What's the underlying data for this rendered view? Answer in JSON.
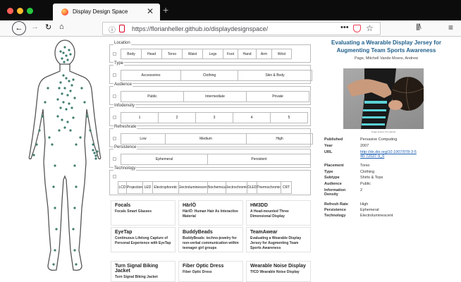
{
  "browser": {
    "tab_title": "Display Design Space",
    "tab_close": "✕",
    "new_tab": "+",
    "back": "←",
    "forward": "→",
    "reload": "↻",
    "home": "⌂",
    "info_icon": "ⓘ",
    "url": "https://florianheller.github.io/displaydesignspace/",
    "page_actions": "•••",
    "bookmark": "☆",
    "library": "|||\\",
    "menu": "≡",
    "colors": {
      "close": "#ff5f57",
      "minimize": "#febc2e",
      "maximize": "#28c840"
    }
  },
  "filters": [
    {
      "legend": "Location",
      "options": [
        "Body",
        "Head",
        "Torso",
        "Waist",
        "Legs",
        "Foot",
        "Hand",
        "Arm",
        "Wrist"
      ]
    },
    {
      "legend": "Type",
      "options": [
        "Accessories",
        "Clothing",
        "Skin & Body"
      ]
    },
    {
      "legend": "Audience",
      "options": [
        "Public",
        "Intermediate",
        "Private"
      ]
    },
    {
      "legend": "Infodensity",
      "options": [
        "1",
        "2",
        "3",
        "4",
        "5"
      ]
    },
    {
      "legend": "Refreshrate",
      "options": [
        "Low",
        "Medium",
        "High"
      ]
    },
    {
      "legend": "Persistence",
      "options": [
        "Ephemeral",
        "Persistent"
      ]
    },
    {
      "legend": "Technology",
      "options": [
        "LCD",
        "Projection",
        "LED",
        "Electrophoretic",
        "Electroluminescent",
        "Biochemical",
        "Electrochromic",
        "OLED",
        "Thermochromic",
        "CRT"
      ]
    }
  ],
  "cards": [
    {
      "title": "Focals",
      "subtitle": "Focals Smart Glasses"
    },
    {
      "title": "HärlÖ",
      "subtitle": "HärlÖ: Human Hair As Interactive Material"
    },
    {
      "title": "HM3DD",
      "subtitle": "A Head-mounted Three Dimensional Display"
    },
    {
      "title": "EyeTap",
      "subtitle": "Continuous Lifelong Capture of Personal Experience with EyeTap"
    },
    {
      "title": "BuddyBeads",
      "subtitle": "BuddyBeads: techno-jewelry for non-verbal communication within teenager girl groups"
    },
    {
      "title": "TeamAwear",
      "subtitle": "Evaluating a Wearable Display Jersey for Augmenting Team Sports Awareness"
    },
    {
      "title": "Turn Signal Biking Jacket",
      "subtitle": "Turn Signal Biking Jacket"
    },
    {
      "title": "Fiber Optic Dress",
      "subtitle": "Fiber Optic Dress"
    },
    {
      "title": "Wearable Noise Display",
      "subtitle": "TfCD Wearable Noise Display"
    }
  ],
  "detail": {
    "title": "Evaluating a Wearable Display Jersey for Augmenting Team Sports Awareness",
    "authors": "Page, Mitchell      Vande Moere, Andrew",
    "image_caption": "Image source: It's Learner",
    "fields": [
      {
        "key": "Published",
        "value": "Pervasive Computing"
      },
      {
        "key": "Year",
        "value": "2007"
      },
      {
        "key": "URL",
        "value": "http://dx.doi.org/10.1007/978-3-540-72037-9_6"
      },
      {
        "key": "Placement",
        "value": "Torso"
      },
      {
        "key": "Type",
        "value": "Clothing"
      },
      {
        "key": "Subtype",
        "value": "Shirts & Tops"
      },
      {
        "key": "Audience",
        "value": "Public"
      },
      {
        "key": "Information Density",
        "value": "2"
      },
      {
        "key": "Refresh Rate",
        "value": "High"
      },
      {
        "key": "Persistence",
        "value": "Ephemeral"
      },
      {
        "key": "Technology",
        "value": "Electroluminescent"
      }
    ]
  }
}
